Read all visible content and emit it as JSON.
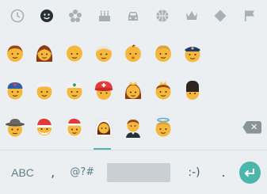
{
  "colors": {
    "accent": "#4db6ac",
    "active_icon": "#263238",
    "inactive_icon": "#a9b0b4",
    "background": "#eceff1"
  },
  "tabs": [
    {
      "icon": "clock-icon",
      "active": false
    },
    {
      "icon": "smiley-icon",
      "active": true
    },
    {
      "icon": "flower-icon",
      "active": false
    },
    {
      "icon": "cake-icon",
      "active": false
    },
    {
      "icon": "car-icon",
      "active": false
    },
    {
      "icon": "ball-icon",
      "active": false
    },
    {
      "icon": "crown-icon",
      "active": false
    },
    {
      "icon": "diamond-icon",
      "active": false
    },
    {
      "icon": "flag-icon",
      "active": false
    }
  ],
  "emoji_rows": [
    [
      "boy",
      "woman",
      "bald-man",
      "older-man",
      "baby",
      "boy-blonde",
      "police-officer"
    ],
    [
      "construction-worker",
      "man-turban",
      "health-worker",
      "rescue-worker",
      "princess",
      "prince",
      "guardsman"
    ],
    [
      "detective",
      "santa",
      "mrs-claus",
      "bride",
      "groom",
      "angel"
    ]
  ],
  "bottom": {
    "abc": "ABC",
    "comma": ",",
    "symbols": "@?#",
    "emoticon": ":-)",
    "period": ".",
    "enter_icon": "enter-icon"
  }
}
